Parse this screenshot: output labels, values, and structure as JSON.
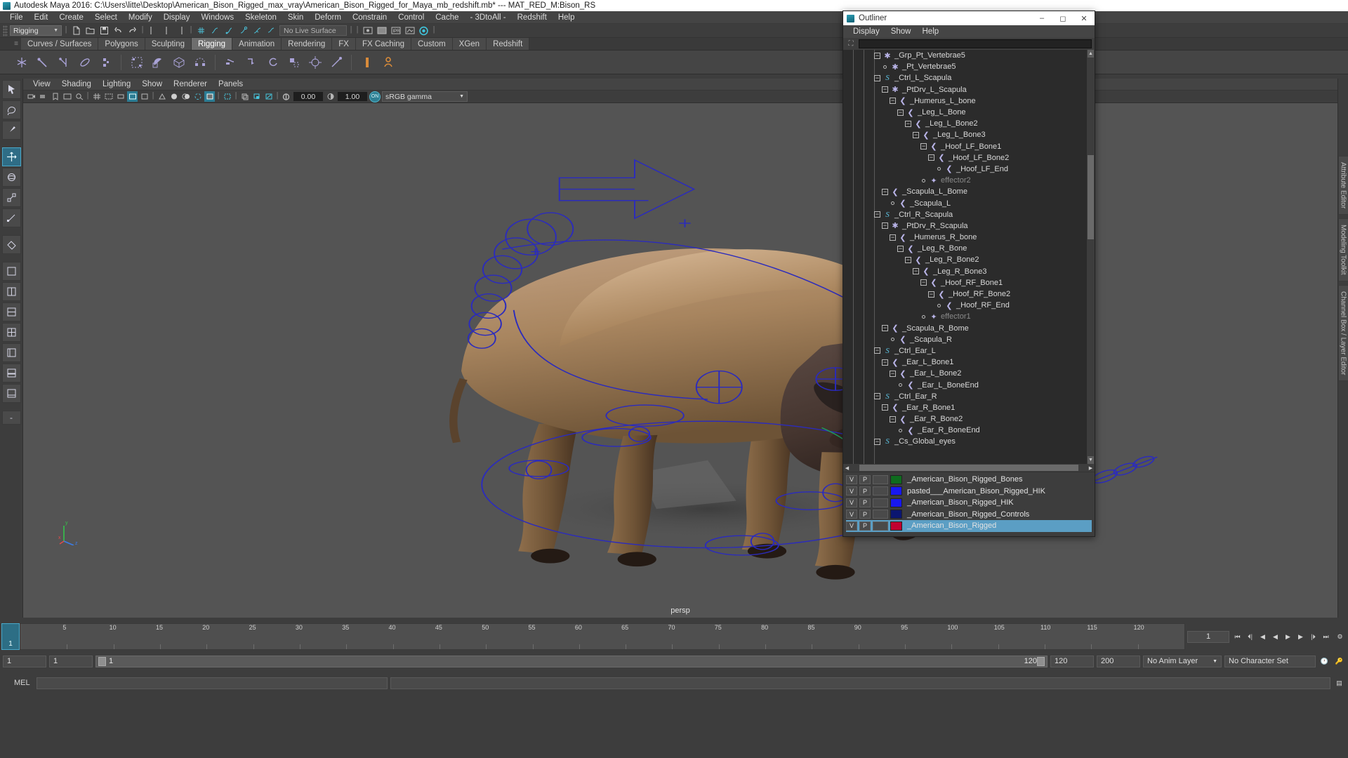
{
  "titlebar": {
    "text": "Autodesk Maya 2016: C:\\Users\\litte\\Desktop\\American_Bison_Rigged_max_vray\\American_Bison_Rigged_for_Maya_mb_redshift.mb*  ---  MAT_RED_M:Bison_RS"
  },
  "menubar": {
    "items": [
      "File",
      "Edit",
      "Create",
      "Select",
      "Modify",
      "Display",
      "Windows",
      "Skeleton",
      "Skin",
      "Deform",
      "Constrain",
      "Control",
      "Cache",
      "- 3DtoAll -",
      "Redshift",
      "Help"
    ]
  },
  "statusrow": {
    "menuset": "Rigging",
    "live_surface": "No Live Surface"
  },
  "shelf": {
    "tabs": [
      "Curves / Surfaces",
      "Polygons",
      "Sculpting",
      "Rigging",
      "Animation",
      "Rendering",
      "FX",
      "FX Caching",
      "Custom",
      "XGen",
      "Redshift"
    ],
    "active": "Rigging"
  },
  "viewport": {
    "menus": [
      "View",
      "Shading",
      "Lighting",
      "Show",
      "Renderer",
      "Panels"
    ],
    "exposure": "0.00",
    "gamma": "1.00",
    "color_mgmt_toggle": "ON",
    "color_profile": "sRGB gamma",
    "camera_label": "persp"
  },
  "righttabs": [
    "Attribute Editor",
    "Modeling Toolkit",
    "Channel Box / Layer Editor"
  ],
  "timeline": {
    "current_frame": "1",
    "ticks": [
      "5",
      "10",
      "15",
      "20",
      "25",
      "30",
      "35",
      "40",
      "45",
      "50",
      "55",
      "60",
      "65",
      "70",
      "75",
      "80",
      "85",
      "90",
      "95",
      "100",
      "105",
      "110",
      "115",
      "120"
    ],
    "frame_field": "1"
  },
  "range": {
    "start": "1",
    "start2": "1",
    "range_start": "1",
    "range_end": "120",
    "anim_end": "120",
    "playback_end": "200",
    "anim_layer": "No Anim Layer",
    "character_set": "No Character Set"
  },
  "command": {
    "label": "MEL",
    "input": "",
    "output": ""
  },
  "outliner": {
    "title": "Outliner",
    "menus": [
      "Display",
      "Show",
      "Help"
    ],
    "search_value": "",
    "window_buttons": [
      "–",
      "❑",
      "✕"
    ],
    "tree": [
      {
        "depth": 4,
        "icon": "star",
        "expander": "plus",
        "label": "_Grp_Pt_Vertebrae5",
        "dim": false
      },
      {
        "depth": 5,
        "icon": "star",
        "expander": "leaf",
        "label": "_Pt_Vertebrae5",
        "dim": false
      },
      {
        "depth": 4,
        "icon": "curve",
        "expander": "plus",
        "label": "_Ctrl_L_Scapula",
        "dim": false
      },
      {
        "depth": 5,
        "icon": "star",
        "expander": "plus",
        "label": "_PtDrv_L_Scapula",
        "dim": false
      },
      {
        "depth": 6,
        "icon": "joint",
        "expander": "plus",
        "label": "_Humerus_L_bone",
        "dim": false
      },
      {
        "depth": 7,
        "icon": "joint",
        "expander": "plus",
        "label": "_Leg_L_Bone",
        "dim": false
      },
      {
        "depth": 8,
        "icon": "joint",
        "expander": "plus",
        "label": "_Leg_L_Bone2",
        "dim": false
      },
      {
        "depth": 9,
        "icon": "joint",
        "expander": "plus",
        "label": "_Leg_L_Bone3",
        "dim": false
      },
      {
        "depth": 10,
        "icon": "joint",
        "expander": "plus",
        "label": "_Hoof_LF_Bone1",
        "dim": false
      },
      {
        "depth": 11,
        "icon": "joint",
        "expander": "plus",
        "label": "_Hoof_LF_Bone2",
        "dim": false
      },
      {
        "depth": 12,
        "icon": "joint",
        "expander": "leaf",
        "label": "_Hoof_LF_End",
        "dim": false
      },
      {
        "depth": 10,
        "icon": "eff",
        "expander": "leaf",
        "label": "effector2",
        "dim": true
      },
      {
        "depth": 5,
        "icon": "joint",
        "expander": "plus",
        "label": "_Scapula_L_Bome",
        "dim": false
      },
      {
        "depth": 6,
        "icon": "joint",
        "expander": "leaf",
        "label": "_Scapula_L",
        "dim": false
      },
      {
        "depth": 4,
        "icon": "curve",
        "expander": "plus",
        "label": "_Ctrl_R_Scapula",
        "dim": false
      },
      {
        "depth": 5,
        "icon": "star",
        "expander": "plus",
        "label": "_PtDrv_R_Scapula",
        "dim": false
      },
      {
        "depth": 6,
        "icon": "joint",
        "expander": "plus",
        "label": "_Humerus_R_bone",
        "dim": false
      },
      {
        "depth": 7,
        "icon": "joint",
        "expander": "plus",
        "label": "_Leg_R_Bone",
        "dim": false
      },
      {
        "depth": 8,
        "icon": "joint",
        "expander": "plus",
        "label": "_Leg_R_Bone2",
        "dim": false
      },
      {
        "depth": 9,
        "icon": "joint",
        "expander": "plus",
        "label": "_Leg_R_Bone3",
        "dim": false
      },
      {
        "depth": 10,
        "icon": "joint",
        "expander": "plus",
        "label": "_Hoof_RF_Bone1",
        "dim": false
      },
      {
        "depth": 11,
        "icon": "joint",
        "expander": "plus",
        "label": "_Hoof_RF_Bone2",
        "dim": false
      },
      {
        "depth": 12,
        "icon": "joint",
        "expander": "leaf",
        "label": "_Hoof_RF_End",
        "dim": false
      },
      {
        "depth": 10,
        "icon": "eff",
        "expander": "leaf",
        "label": "effector1",
        "dim": true
      },
      {
        "depth": 5,
        "icon": "joint",
        "expander": "plus",
        "label": "_Scapula_R_Bome",
        "dim": false
      },
      {
        "depth": 6,
        "icon": "joint",
        "expander": "leaf",
        "label": "_Scapula_R",
        "dim": false
      },
      {
        "depth": 4,
        "icon": "curve",
        "expander": "plus",
        "label": "_Ctrl_Ear_L",
        "dim": false
      },
      {
        "depth": 5,
        "icon": "joint",
        "expander": "plus",
        "label": "_Ear_L_Bone1",
        "dim": false
      },
      {
        "depth": 6,
        "icon": "joint",
        "expander": "plus",
        "label": "_Ear_L_Bone2",
        "dim": false
      },
      {
        "depth": 7,
        "icon": "joint",
        "expander": "leaf",
        "label": "_Ear_L_BoneEnd",
        "dim": false
      },
      {
        "depth": 4,
        "icon": "curve",
        "expander": "plus",
        "label": "_Ctrl_Ear_R",
        "dim": false
      },
      {
        "depth": 5,
        "icon": "joint",
        "expander": "plus",
        "label": "_Ear_R_Bone1",
        "dim": false
      },
      {
        "depth": 6,
        "icon": "joint",
        "expander": "plus",
        "label": "_Ear_R_Bone2",
        "dim": false
      },
      {
        "depth": 7,
        "icon": "joint",
        "expander": "leaf",
        "label": "_Ear_R_BoneEnd",
        "dim": false
      },
      {
        "depth": 4,
        "icon": "curve",
        "expander": "plus",
        "label": "_Cs_Global_eyes",
        "dim": false
      }
    ],
    "layers": [
      {
        "v": "V",
        "p": "P",
        "color": "#0f6b1e",
        "name": "_American_Bison_Rigged_Bones",
        "selected": false
      },
      {
        "v": "V",
        "p": "P",
        "color": "#1818f0",
        "name": "pasted___American_Bison_Rigged_HIK",
        "selected": false
      },
      {
        "v": "V",
        "p": "P",
        "color": "#1818f0",
        "name": "_American_Bison_Rigged_HIK",
        "selected": false
      },
      {
        "v": "V",
        "p": "P",
        "color": "#0b1670",
        "name": "_American_Bison_Rigged_Controls",
        "selected": false
      },
      {
        "v": "V",
        "p": "P",
        "color": "#c00030",
        "name": "_American_Bison_Rigged",
        "selected": true
      }
    ]
  },
  "colors": {
    "accent": "#2f7f93",
    "selection": "#5b9ec4",
    "rig_curve": "#2b2bbd",
    "viewport_bg": "#545454"
  }
}
